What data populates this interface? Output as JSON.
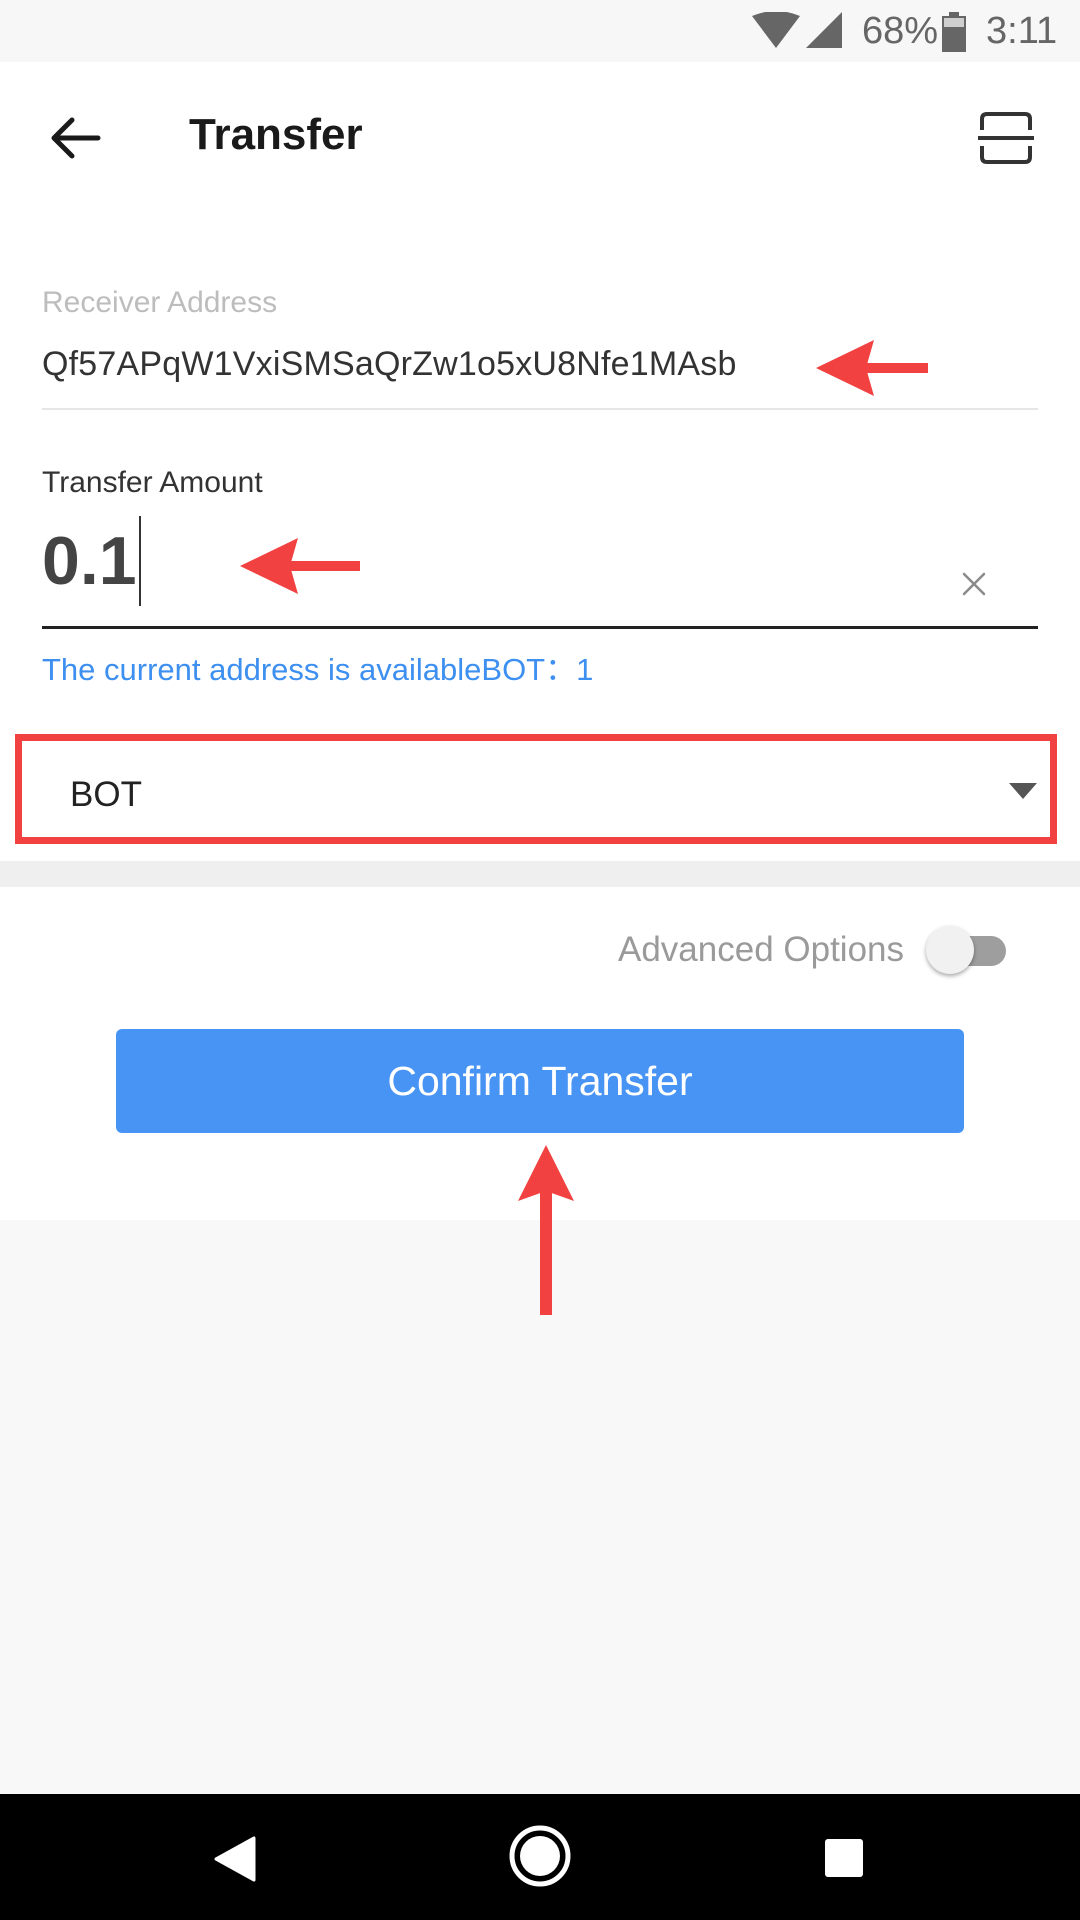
{
  "status_bar": {
    "battery_percent": "68%",
    "time": "3:11",
    "icons": [
      "wifi-icon",
      "cell-signal-icon",
      "battery-icon"
    ]
  },
  "app_bar": {
    "title": "Transfer",
    "back_icon": "arrow-left-icon",
    "scan_icon": "scan-icon"
  },
  "form": {
    "receiver_label": "Receiver Address",
    "receiver_value": "Qf57APqW1VxiSMSaQrZw1o5xU8Nfe1MAsb",
    "amount_label": "Transfer Amount",
    "amount_value": "0.1",
    "available_text": "The current address is availableBOT：1",
    "token_selected": "BOT"
  },
  "advanced": {
    "label": "Advanced Options",
    "enabled": false
  },
  "confirm_label": "Confirm Transfer",
  "annotation": {
    "color": "#f24141"
  },
  "colors": {
    "accent": "#4894f5",
    "link": "#3d8ff0",
    "highlight": "#f24141"
  },
  "nav_bar": {
    "icons": [
      "nav-back-icon",
      "nav-home-icon",
      "nav-recent-icon"
    ]
  }
}
